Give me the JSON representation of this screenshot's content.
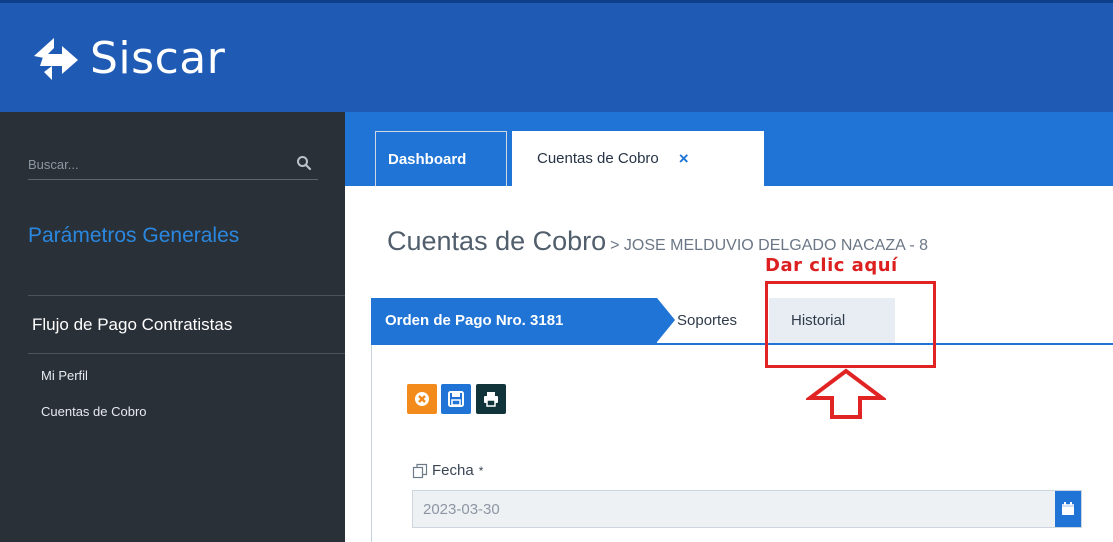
{
  "app": {
    "title": "Siscar"
  },
  "sidebar": {
    "search_placeholder": "Buscar...",
    "section_title": "Parámetros Generales",
    "flow_title": "Flujo de Pago Contratistas",
    "links": [
      "Mi Perfil",
      "Cuentas de Cobro"
    ]
  },
  "tabs": {
    "dashboard": "Dashboard",
    "cuentas": "Cuentas de Cobro",
    "close_glyph": "×"
  },
  "page": {
    "title": "Cuentas de Cobro",
    "subtitle": "> JOSE MELDUVIO DELGADO NACAZA - 8"
  },
  "inner_tabs": {
    "orden": "Orden de Pago Nro. 3181",
    "soportes": "Soportes",
    "historial": "Historial"
  },
  "toolbar": {
    "icons": [
      "cancel-icon",
      "save-icon",
      "print-icon"
    ]
  },
  "form": {
    "fecha_label": "Fecha",
    "fecha_required": "*",
    "fecha_value": "2023-03-30"
  },
  "annotation": {
    "label": "Dar clic aquí"
  },
  "colors": {
    "header": "#1f5bb5",
    "sidebar": "#2a3037",
    "accent": "#1f74d6",
    "annotation": "#e02424",
    "cancel_button": "#f28a1c",
    "print_button": "#10343a"
  }
}
